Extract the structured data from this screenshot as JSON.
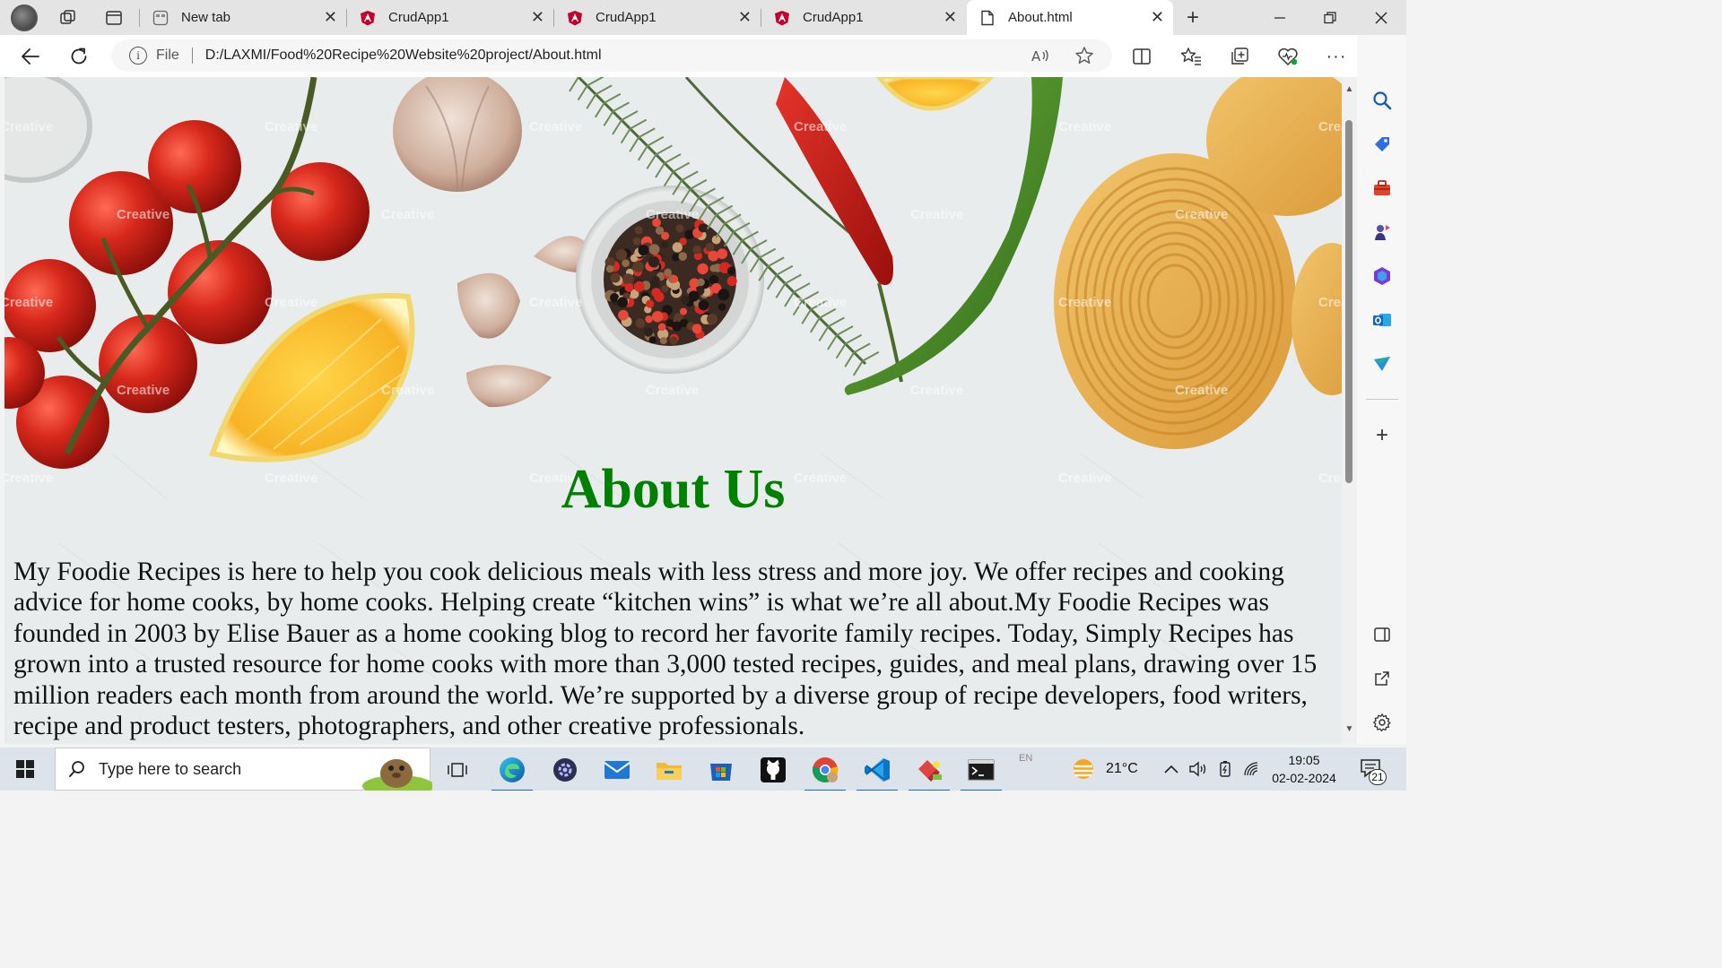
{
  "browser": {
    "tabs": [
      {
        "title": "New tab",
        "icon": "newtab-icon"
      },
      {
        "title": "CrudApp1",
        "icon": "angular-icon"
      },
      {
        "title": "CrudApp1",
        "icon": "angular-icon"
      },
      {
        "title": "CrudApp1",
        "icon": "angular-icon"
      },
      {
        "title": "About.html",
        "icon": "file-icon",
        "active": true
      }
    ],
    "address": {
      "scheme_label": "File",
      "url": "D:/LAXMI/Food%20Recipe%20Website%20project/About.html"
    }
  },
  "page": {
    "title": "About Us",
    "body": "My Foodie Recipes is here to help you cook delicious meals with less stress and more joy. We offer recipes and cooking advice for home cooks, by home cooks. Helping create “kitchen wins” is what we’re all about.My Foodie Recipes was founded in 2003 by Elise Bauer as a home cooking blog to record her favorite family recipes. Today, Simply Recipes has grown into a trusted resource for home cooks with more than 3,000 tested recipes, guides, and meal plans, drawing over 15 million readers each month from around the world. We’re supported by a diverse group of recipe developers, food writers, recipe and product testers, photographers, and other creative professionals.",
    "watermark": "Creative",
    "colors": {
      "title": "#008000",
      "text": "#111111"
    }
  },
  "taskbar": {
    "search_placeholder": "Type here to search",
    "language": "EN",
    "weather": "21°C",
    "time": "19:05",
    "date": "02-02-2024",
    "notifications": "21",
    "apps": [
      "task-view-icon",
      "edge-icon",
      "settings-app-icon",
      "mail-icon",
      "file-explorer-icon",
      "store-icon",
      "github-icon",
      "chrome-icon",
      "vscode-icon",
      "app-icon",
      "terminal-icon"
    ]
  },
  "sidebar": {
    "items": [
      "search-icon",
      "tag-icon",
      "toolbox-icon",
      "games-icon",
      "office-icon",
      "outlook-icon",
      "send-icon",
      "add-icon",
      "layout-icon",
      "external-link-icon",
      "settings-icon"
    ]
  }
}
